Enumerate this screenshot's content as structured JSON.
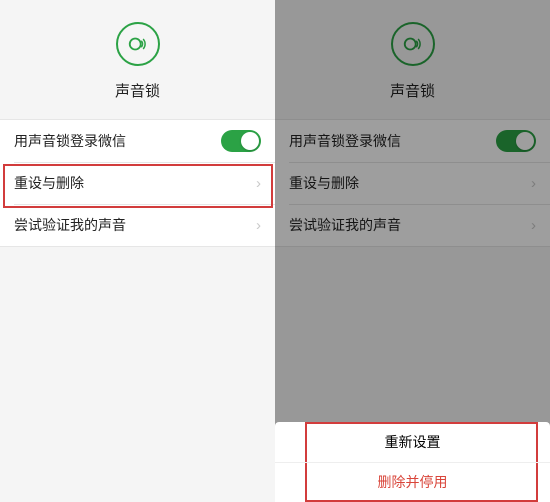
{
  "title": "声音锁",
  "rows": {
    "login": "用声音锁登录微信",
    "reset": "重设与删除",
    "verify": "尝试验证我的声音"
  },
  "sheet": {
    "reset": "重新设置",
    "delete": "删除并停用"
  },
  "colors": {
    "accent": "#2ba245",
    "danger": "#d9453a",
    "highlight": "#d23c3c"
  }
}
